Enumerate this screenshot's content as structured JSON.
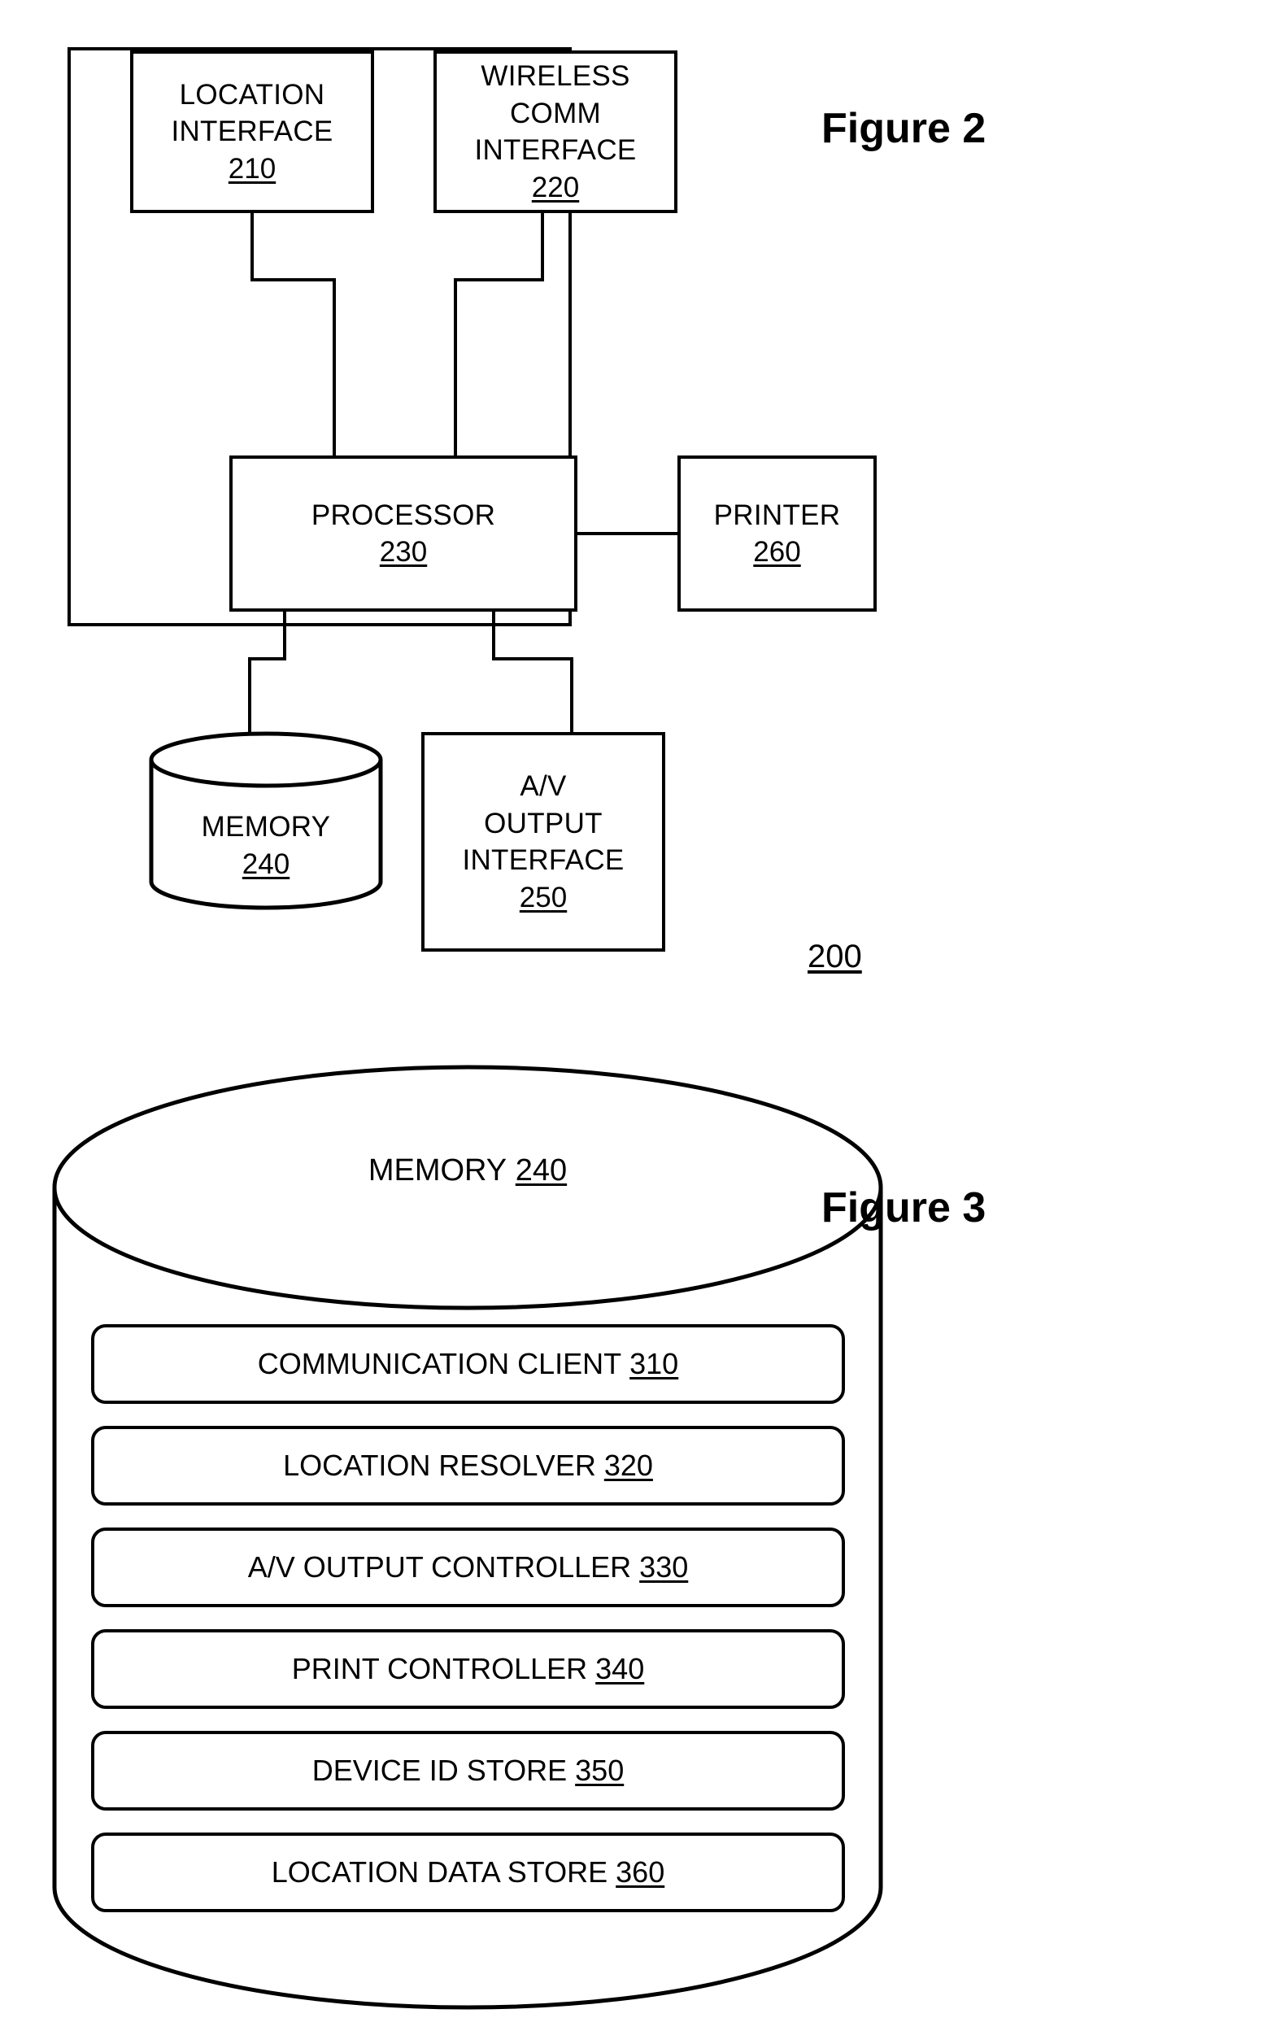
{
  "figures": [
    {
      "title": "Figure 2",
      "ref": "200",
      "blocks": [
        {
          "id": "location-interface",
          "lines": [
            "LOCATION",
            "INTERFACE"
          ],
          "ref": "210"
        },
        {
          "id": "wireless-comm-interface",
          "lines": [
            "WIRELESS",
            "COMM",
            "INTERFACE"
          ],
          "ref": "220"
        },
        {
          "id": "processor",
          "lines": [
            "PROCESSOR"
          ],
          "ref": "230"
        },
        {
          "id": "printer",
          "lines": [
            "PRINTER"
          ],
          "ref": "260"
        },
        {
          "id": "memory",
          "lines": [
            "MEMORY"
          ],
          "ref": "240"
        },
        {
          "id": "av-output-interface",
          "lines": [
            "A/V",
            "OUTPUT",
            "INTERFACE"
          ],
          "ref": "250"
        }
      ]
    },
    {
      "title": "Figure 3",
      "cylinder_label": "MEMORY",
      "cylinder_ref": "240",
      "rows": [
        {
          "id": "communication-client",
          "label": "COMMUNICATION CLIENT",
          "ref": "310"
        },
        {
          "id": "location-resolver",
          "label": "LOCATION RESOLVER",
          "ref": "320"
        },
        {
          "id": "av-output-controller",
          "label": "A/V OUTPUT CONTROLLER",
          "ref": "330"
        },
        {
          "id": "print-controller",
          "label": "PRINT CONTROLLER",
          "ref": "340"
        },
        {
          "id": "device-id-store",
          "label": "DEVICE ID STORE",
          "ref": "350"
        },
        {
          "id": "location-data-store",
          "label": "LOCATION DATA STORE",
          "ref": "360"
        }
      ]
    }
  ],
  "colors": {
    "ink": "#000000",
    "paper": "#ffffff"
  }
}
